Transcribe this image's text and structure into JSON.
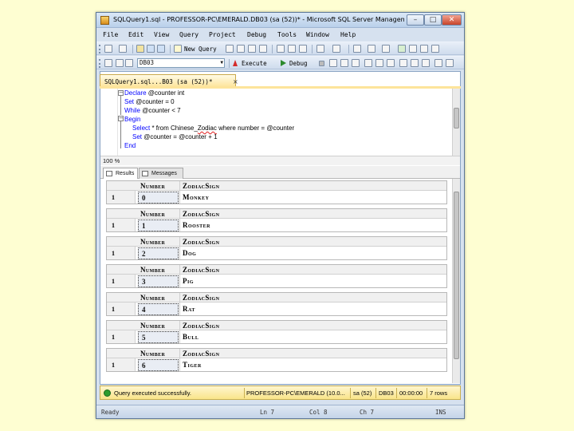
{
  "window": {
    "title": "SQLQuery1.sql - PROFESSOR-PC\\EMERALD.DB03 (sa (52))* - Microsoft SQL Server Management Stu...",
    "min_glyph": "–",
    "max_glyph": "□",
    "close_glyph": "✕"
  },
  "menu": [
    "File",
    "Edit",
    "View",
    "Query",
    "Project",
    "Debug",
    "Tools",
    "Window",
    "Help"
  ],
  "toolbar1": {
    "new_query_label": "New Query"
  },
  "toolbar2": {
    "database": "DB03",
    "execute_label": "Execute",
    "debug_label": "Debug"
  },
  "doc_tab": {
    "label": "SQLQuery1.sql...B03 (sa (52))*",
    "close_glyph": "×"
  },
  "editor": {
    "lines": [
      {
        "kw": "Declare",
        "rest": " @counter int"
      },
      {
        "kw": "Set",
        "rest": " @counter = 0"
      },
      {
        "kw": "While",
        "rest": " @counter < 7"
      },
      {
        "kw": "Begin",
        "rest": ""
      },
      {
        "kw": "Select",
        "rest_a": " * from Chinese_",
        "err": "Zodiac",
        "rest_b": " where number = @counter"
      },
      {
        "kw": "Set",
        "rest": " @counter = @counter + 1"
      },
      {
        "kw": "End",
        "rest": ""
      }
    ],
    "outline_minus": "−"
  },
  "zoom": {
    "label": "100 %"
  },
  "results_tabs": {
    "results": "Results",
    "messages": "Messages"
  },
  "results": {
    "headers": [
      "Number",
      "ZodiacSign"
    ],
    "grids": [
      {
        "row": "1",
        "number": "0",
        "sign": "Monkey"
      },
      {
        "row": "1",
        "number": "1",
        "sign": "Rooster"
      },
      {
        "row": "1",
        "number": "2",
        "sign": "Dog"
      },
      {
        "row": "1",
        "number": "3",
        "sign": "Pig"
      },
      {
        "row": "1",
        "number": "4",
        "sign": "Rat"
      },
      {
        "row": "1",
        "number": "5",
        "sign": "Bull"
      },
      {
        "row": "1",
        "number": "6",
        "sign": "Tiger"
      }
    ]
  },
  "status": {
    "message": "Query executed successfully.",
    "server": "PROFESSOR-PC\\EMERALD (10.0...",
    "user": "sa (52)",
    "db": "DB03",
    "time": "00:00:00",
    "rows": "7 rows"
  },
  "statusbar": {
    "ready": "Ready",
    "ln": "Ln 7",
    "col": "Col 8",
    "ch": "Ch 7",
    "ins": "INS"
  }
}
